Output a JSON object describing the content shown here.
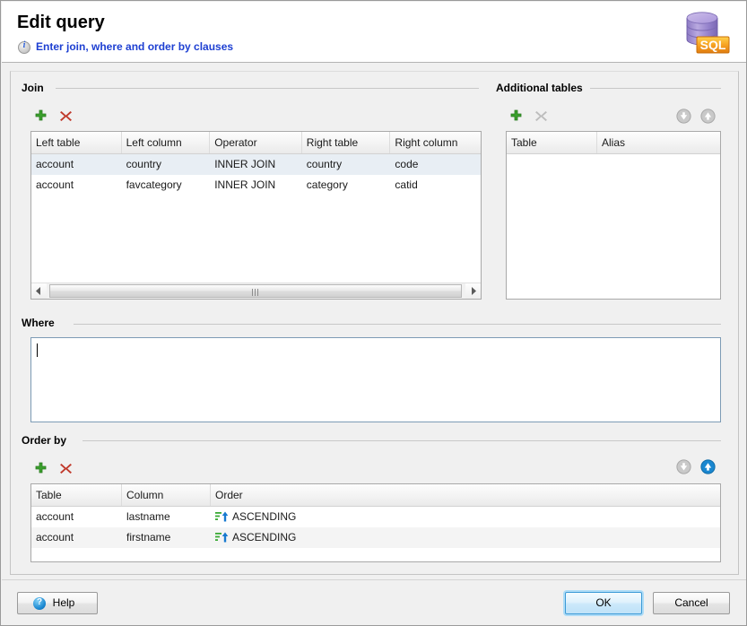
{
  "header": {
    "title": "Edit query",
    "subtitle": "Enter join, where and order by clauses",
    "info_icon": "info-icon",
    "app_icon": "sql-database-icon",
    "app_icon_label": "SQL"
  },
  "join": {
    "legend": "Join",
    "add_label": "+",
    "remove_label": "✕",
    "columns": [
      "Left table",
      "Left column",
      "Operator",
      "Right table",
      "Right column"
    ],
    "rows": [
      {
        "left_table": "account",
        "left_column": "country",
        "operator": "INNER JOIN",
        "right_table": "country",
        "right_column": "code",
        "selected": true
      },
      {
        "left_table": "account",
        "left_column": "favcategory",
        "operator": "INNER JOIN",
        "right_table": "category",
        "right_column": "catid",
        "selected": false
      }
    ]
  },
  "additional_tables": {
    "legend": "Additional tables",
    "add_label": "+",
    "remove_label": "✕",
    "move_down_icon": "arrow-down-circle-icon",
    "move_up_icon": "arrow-up-circle-icon",
    "columns": [
      "Table",
      "Alias"
    ],
    "rows": []
  },
  "where": {
    "legend": "Where",
    "value": "",
    "placeholder": ""
  },
  "order_by": {
    "legend": "Order by",
    "add_label": "+",
    "remove_label": "✕",
    "move_down_icon": "arrow-down-circle-icon",
    "move_up_icon": "arrow-up-circle-icon",
    "columns": [
      "Table",
      "Column",
      "Order"
    ],
    "rows": [
      {
        "table": "account",
        "column": "lastname",
        "order": "ASCENDING",
        "order_icon": "sort-ascending-icon"
      },
      {
        "table": "account",
        "column": "firstname",
        "order": "ASCENDING",
        "order_icon": "sort-ascending-icon"
      }
    ]
  },
  "footer": {
    "help_label": "Help",
    "help_icon": "help-circle-icon",
    "ok_label": "OK",
    "cancel_label": "Cancel"
  },
  "colors": {
    "link": "#1d3fd2",
    "add_green": "#3aa02c",
    "remove_red": "#c0392b",
    "disabled_gray": "#b5b5b5",
    "accent_blue": "#1a87d0",
    "selection": "#e8eef4",
    "sort_arrow_blue": "#1779d0",
    "sort_bars_green": "#3aaa35"
  }
}
